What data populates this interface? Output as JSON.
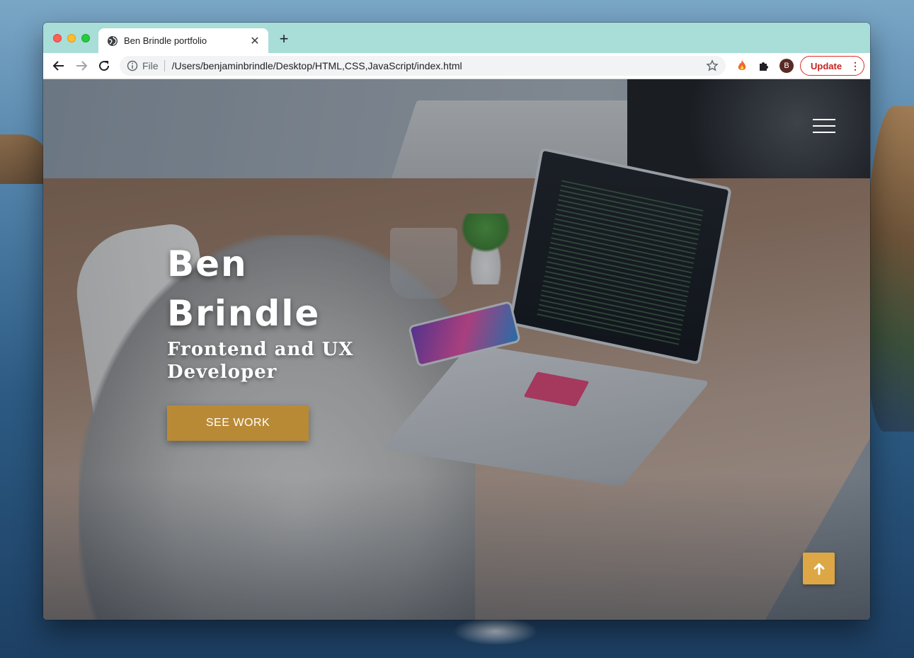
{
  "browser": {
    "tab": {
      "title": "Ben Brindle portfolio",
      "favicon": "globe-icon",
      "close_icon": "close-icon"
    },
    "new_tab_icon": "plus-icon",
    "omnibox": {
      "scheme_label": "File",
      "url": "/Users/benjaminbrindle/Desktop/HTML,CSS,JavaScript/index.html"
    },
    "profile_initial": "B",
    "update_label": "Update",
    "colors": {
      "tabstrip": "#a9ddd8",
      "update_accent": "#d93025"
    }
  },
  "hero": {
    "name_line1": "Ben",
    "name_line2": "Brindle",
    "subtitle_line1": "Frontend and UX",
    "subtitle_line2": "Developer",
    "cta_label": "SEE WORK",
    "colors": {
      "cta": "#b98a36",
      "scroll_top": "#dca744"
    }
  },
  "icons": {
    "menu": "hamburger-menu-icon",
    "scroll_top": "arrow-up-icon"
  }
}
